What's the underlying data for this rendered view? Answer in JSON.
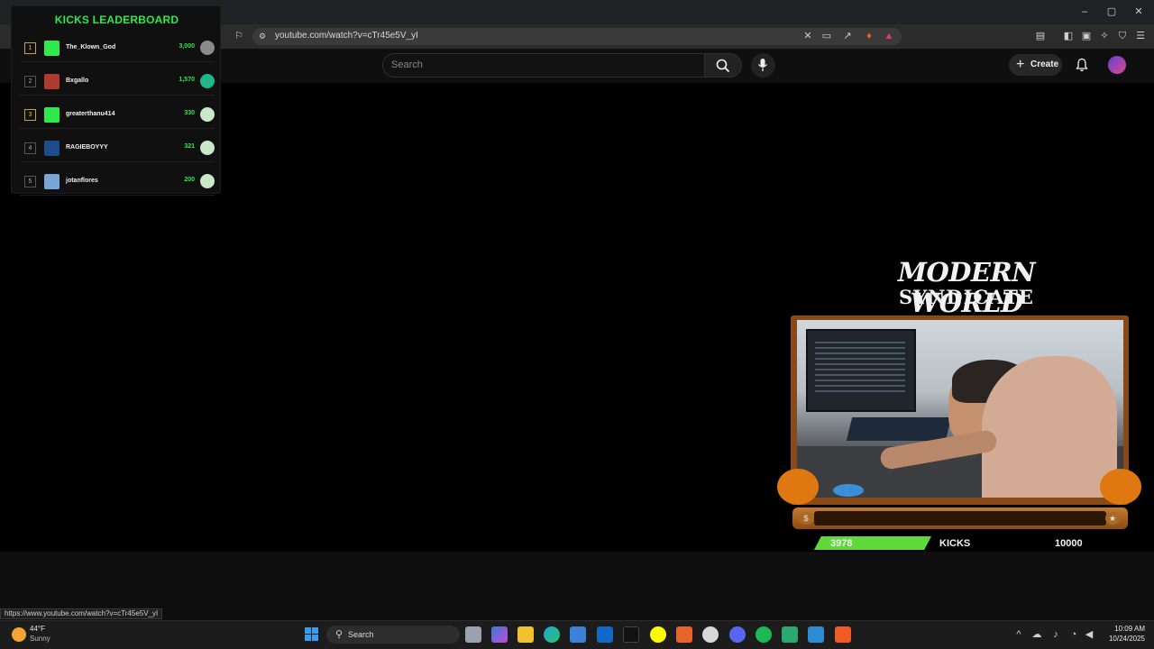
{
  "browser": {
    "url": "youtube.com/watch?v=cTr45e5V_yI",
    "window_controls": [
      "–",
      "▢",
      "✕"
    ]
  },
  "youtube": {
    "search_placeholder": "Search",
    "create_label": "Create"
  },
  "leaderboard": {
    "title": "KICKS LEADERBOARD",
    "entries": [
      {
        "rank": "1",
        "name": "The_Klown_God",
        "score": "3,000",
        "avatar_color": "#2ee84c",
        "badge_color": "#8a8a8a"
      },
      {
        "rank": "2",
        "name": "Bxgallo",
        "score": "1,570",
        "avatar_color": "#b03a2e",
        "badge_color": "#1fb88a"
      },
      {
        "rank": "3",
        "name": "greaterthanu414",
        "score": "330",
        "avatar_color": "#2ee84c",
        "badge_color": "#c8e8c8"
      },
      {
        "rank": "4",
        "name": "RAGIEBOYYY",
        "score": "321",
        "avatar_color": "#1d4c8c",
        "badge_color": "#c8e8c8"
      },
      {
        "rank": "5",
        "name": "jotanflores",
        "score": "200",
        "avatar_color": "#7aa6d6",
        "badge_color": "#c8e8c8"
      }
    ]
  },
  "overlay": {
    "brand_line1": "MODERN WORLD",
    "brand_line2": "SYNDICATE",
    "kicks_current": "3978",
    "kicks_label": "KICKS",
    "kicks_goal": "10000",
    "kicks_progress": 0.3978
  },
  "status_bar_url": "https://www.youtube.com/watch?v=cTr45e5V_yI",
  "taskbar": {
    "weather_temp": "44°F",
    "weather_desc": "Sunny",
    "search_label": "Search",
    "time": "10:09 AM",
    "date": "10/24/2025"
  },
  "colors": {
    "accent_green": "#2ee84c",
    "frame_orange": "#8a4a17",
    "progress_green": "#5fd83b"
  }
}
